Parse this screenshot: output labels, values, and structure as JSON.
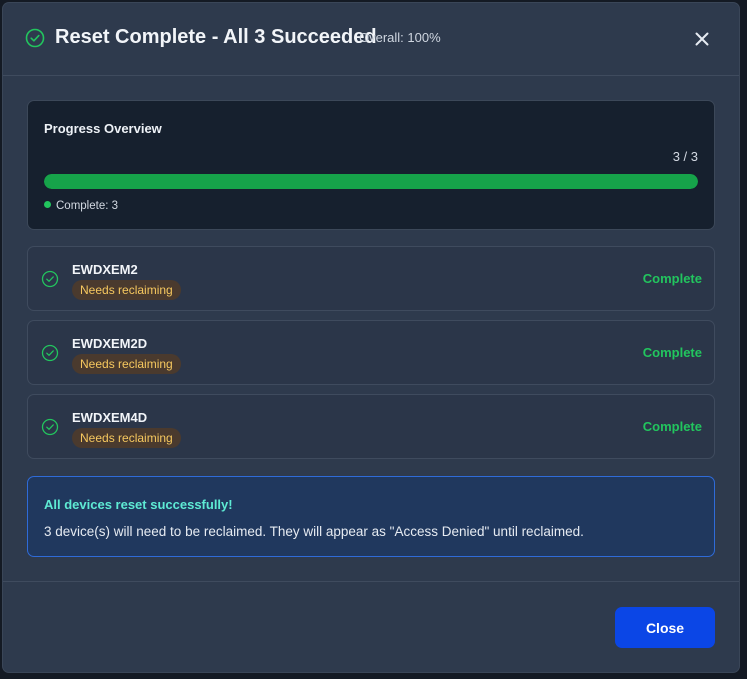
{
  "dialog": {
    "title": "Reset Complete - All 3 Succeeded",
    "overall": "Overall: 100%",
    "icon": "check-circle-icon",
    "close_icon": "close-icon"
  },
  "progress": {
    "title": "Progress Overview",
    "count": "3 / 3",
    "fraction": 1.0,
    "legend": "Complete: 3",
    "bar_color": "#16a34a"
  },
  "devices": [
    {
      "name": "EWDXEM2",
      "badge": "Needs reclaiming",
      "status": "Complete"
    },
    {
      "name": "EWDXEM2D",
      "badge": "Needs reclaiming",
      "status": "Complete"
    },
    {
      "name": "EWDXEM4D",
      "badge": "Needs reclaiming",
      "status": "Complete"
    }
  ],
  "info": {
    "title": "All devices reset successfully!",
    "message": "3 device(s) will need to be reclaimed. They will appear as \"Access Denied\" until reclaimed."
  },
  "footer": {
    "close_label": "Close",
    "button_color": "#0b46e6"
  }
}
